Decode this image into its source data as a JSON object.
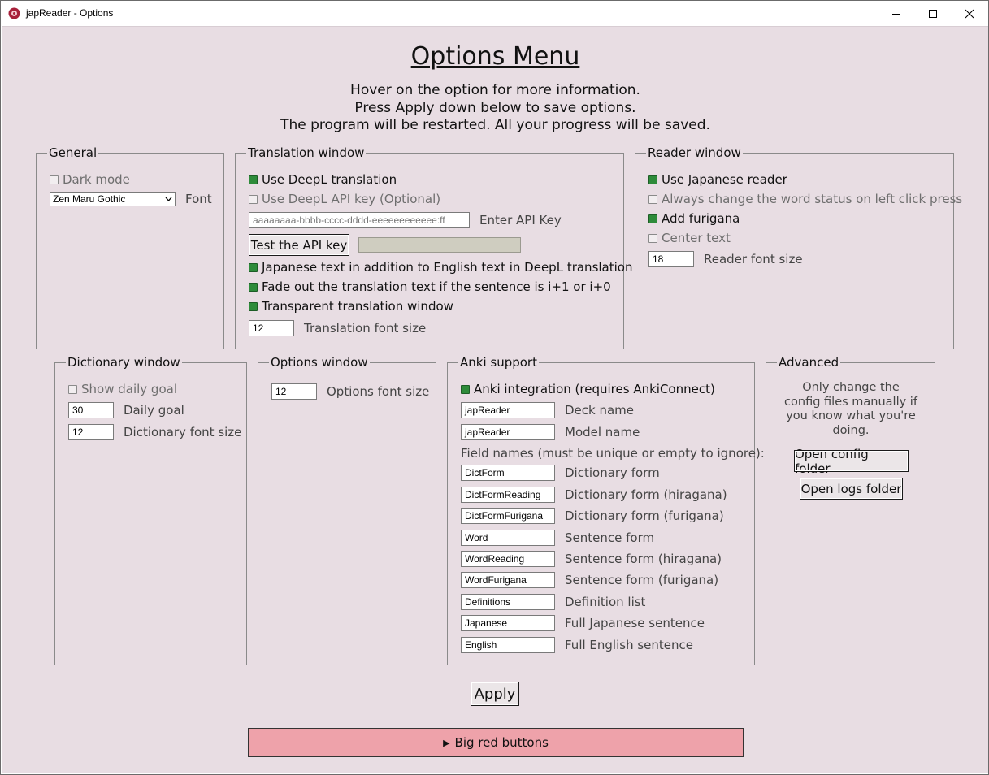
{
  "window": {
    "title": "japReader - Options"
  },
  "header": {
    "heading": "Options Menu",
    "intro_lines": [
      "Hover on the option for more information.",
      "Press Apply down below to save options.",
      "The program will be restarted. All your progress will be saved."
    ]
  },
  "general": {
    "title": "General",
    "dark_mode": "Dark mode",
    "font_value": "Zen Maru Gothic",
    "font_label": "Font"
  },
  "translation": {
    "title": "Translation window",
    "use_deepl": "Use DeepL translation",
    "use_api_key": "Use DeepL API key (Optional)",
    "api_key_placeholder": "aaaaaaaa-bbbb-cccc-dddd-eeeeeeeeeeee:ff",
    "api_key_label": "Enter API Key",
    "test_button": "Test the API key",
    "japanese_text": "Japanese text in addition to English text in DeepL translation",
    "fade_out": "Fade out the translation text if the sentence is i+1 or i+0",
    "transparent": "Transparent translation window",
    "font_size_value": "12",
    "font_size_label": "Translation font size"
  },
  "reader": {
    "title": "Reader window",
    "use_japanese_reader": "Use Japanese reader",
    "always_change": "Always change the word status on left click press",
    "add_furigana": "Add furigana",
    "center_text": "Center text",
    "font_size_value": "18",
    "font_size_label": "Reader font size"
  },
  "dictionary": {
    "title": "Dictionary window",
    "show_daily_goal": "Show daily goal",
    "daily_goal_value": "30",
    "daily_goal_label": "Daily goal",
    "font_size_value": "12",
    "font_size_label": "Dictionary font size"
  },
  "options_window": {
    "title": "Options window",
    "font_size_value": "12",
    "font_size_label": "Options font size"
  },
  "anki": {
    "title": "Anki support",
    "integration": "Anki integration (requires AnkiConnect)",
    "deck_value": "japReader",
    "deck_label": "Deck name",
    "model_value": "japReader",
    "model_label": "Model name",
    "field_names_label": "Field names (must be unique or empty to ignore):",
    "fields": [
      {
        "value": "DictForm",
        "label": "Dictionary form"
      },
      {
        "value": "DictFormReading",
        "label": "Dictionary form (hiragana)"
      },
      {
        "value": "DictFormFurigana",
        "label": "Dictionary form (furigana)"
      },
      {
        "value": "Word",
        "label": "Sentence form"
      },
      {
        "value": "WordReading",
        "label": "Sentence form (hiragana)"
      },
      {
        "value": "WordFurigana",
        "label": "Sentence form (furigana)"
      },
      {
        "value": "Definitions",
        "label": "Definition list"
      },
      {
        "value": "Japanese",
        "label": "Full Japanese sentence"
      },
      {
        "value": "English",
        "label": "Full English sentence"
      }
    ]
  },
  "advanced": {
    "title": "Advanced",
    "note_lines": [
      "Only change the",
      "config files manually if",
      "you know what you're",
      "doing."
    ],
    "open_config": "Open config folder",
    "open_logs": "Open logs folder"
  },
  "footer": {
    "apply": "Apply",
    "big_red": "Big red buttons"
  },
  "colors": {
    "background": "#e8dde3",
    "checkbox_on": "#2e8b3a",
    "big_red": "#eea2aa"
  }
}
